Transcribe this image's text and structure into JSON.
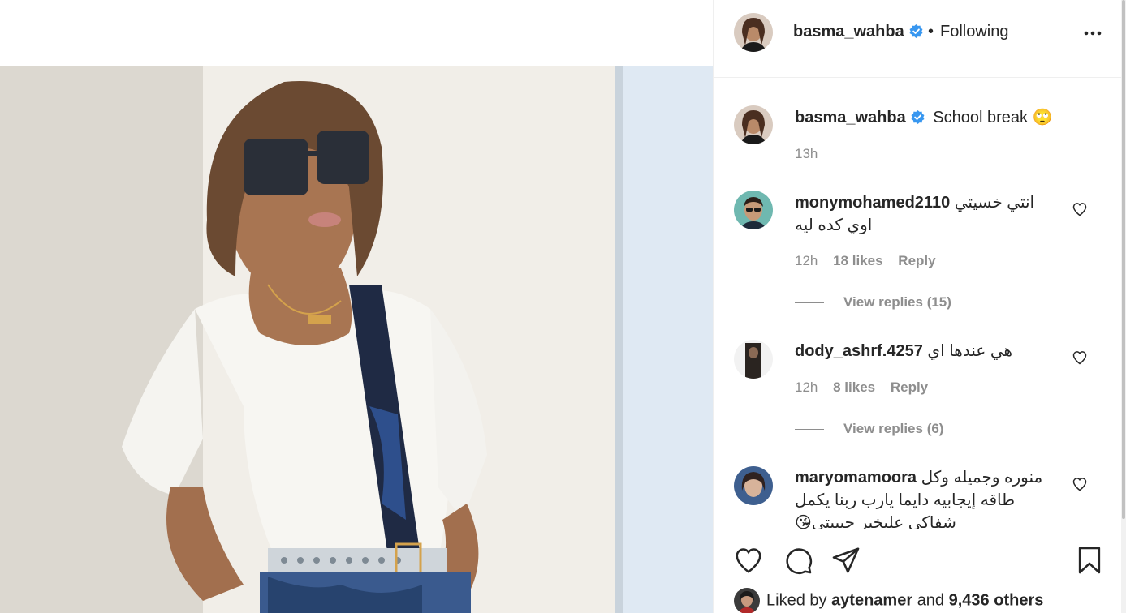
{
  "post": {
    "author": "basma_wahba",
    "follow_status": "Following",
    "separator": "•",
    "caption": "School break",
    "caption_emoji": "🙄",
    "caption_time": "13h"
  },
  "comments": [
    {
      "username": "monymohamed2110",
      "text": "انتي خسيتي اوي كده ليه",
      "time": "12h",
      "likes": "18 likes",
      "reply": "Reply",
      "view_replies": "View replies (15)"
    },
    {
      "username": "dody_ashrf.4257",
      "text": "هي عندها اي",
      "time": "12h",
      "likes": "8 likes",
      "reply": "Reply",
      "view_replies": "View replies (6)"
    },
    {
      "username": "maryomamoora",
      "text": "منوره وجميله وكل طاقه إيجابيه دايما يارب ربنا يكمل شفاكي علىخير حبيبتي😘"
    }
  ],
  "likes_line": {
    "prefix": "Liked by",
    "user": "aytenamer",
    "connector": "and",
    "others": "9,436 others"
  },
  "icons": {
    "verified": "verified-badge-icon",
    "more": "more-options-icon",
    "like": "heart-icon",
    "comment": "comment-bubble-icon",
    "share": "paper-plane-icon",
    "save": "bookmark-icon"
  },
  "colors": {
    "verified": "#3897f0",
    "text": "#262626",
    "muted": "#8e8e8e",
    "divider": "#efefef"
  }
}
